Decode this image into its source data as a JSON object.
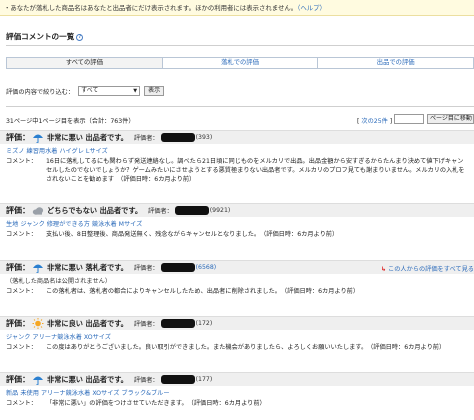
{
  "notice": {
    "text": "・あなたが落札した商品名はあなたと出品者にだけ表示されます。ほかの利用者には表示されません。",
    "help_link": "（ヘルプ）"
  },
  "section": {
    "title": "評価コメントの一覧"
  },
  "tabs": [
    {
      "label": "すべての評価",
      "active": true
    },
    {
      "label": "落札での評価",
      "active": false
    },
    {
      "label": "出品での評価",
      "active": false
    }
  ],
  "filter": {
    "label": "評価の内容で絞り込む：",
    "selected": "すべて",
    "button": "表示"
  },
  "results": {
    "summary": "31ページ中1ページ目を表示（合計：763件）",
    "next_link": "次の25件",
    "page_button": "ページ目に移動"
  },
  "colors": {
    "link": "#2a6aba",
    "header_bg": "#efefef",
    "report_mark": "#dd2222"
  },
  "reviews": [
    {
      "weather_icon": "umbrella-rain-icon",
      "label": "評価：",
      "rating": "非常に悪い 出品者です。",
      "user_label": "評価者：",
      "count": "(393)",
      "count_is_link": false,
      "item": "ミズノ 練習用水着 ハイグレ Lサイズ",
      "item_is_link": true,
      "comment_label": "コメント：",
      "comment": "16日に落札してるにも関わらず発送連絡なし。調べたら21日頃に同じものをメルカリで出品。出品金額から安すぎるからたんまり決めて値下げキャンセルしたのでないでしょうか？ゲームみたいにさせようとする悪質極まりない出品者です。メルカリのプロフ見ても謝まりいません。メルカリの入札をされないことを勧めます　（評価日時：6カ月より前）",
      "report": ""
    },
    {
      "weather_icon": "cloud-icon",
      "label": "評価：",
      "rating": "どちらでもない 出品者です。",
      "user_label": "評価者：",
      "count": "(9921)",
      "count_is_link": false,
      "item": "生地 ジャンク 修理ができる方 競泳水着 Mサイズ",
      "item_is_link": true,
      "comment_label": "コメント：",
      "comment": "支払い後、8日整理後、商品発送無く、残念ながらキャンセルとなりました。　（評価日時：6カ月より前）",
      "report": ""
    },
    {
      "weather_icon": "umbrella-rain-icon",
      "label": "評価：",
      "rating": "非常に悪い 落札者です。",
      "user_label": "評価者：",
      "count": "(6568)",
      "count_is_link": true,
      "item": "（落札した商品名は公開されません）",
      "item_is_link": false,
      "comment_label": "コメント：",
      "comment": "この落札者は、落札者の都合によりキャンセルしたため、出品者に削除されました。　（評価日時：6カ月より前）",
      "report": "この人からの評価をすべて見る"
    },
    {
      "weather_icon": "sun-icon",
      "label": "評価：",
      "rating": "非常に良い 出品者です。",
      "user_label": "評価者：",
      "count": "(172)",
      "count_is_link": false,
      "item": "ジャンク アリーナ競泳水着 XOサイズ",
      "item_is_link": true,
      "comment_label": "コメント：",
      "comment": "この度はありがとうございました。良い取引ができました。また機会がありましたら、よろしくお願いいたします。　（評価日時：6カ月より前）",
      "report": ""
    },
    {
      "weather_icon": "umbrella-rain-icon",
      "label": "評価：",
      "rating": "非常に悪い 出品者です。",
      "user_label": "評価者：",
      "count": "(177)",
      "count_is_link": false,
      "item": "新品 未使用 アリーナ競泳水着 XOサイズ ブラック&ブルー",
      "item_is_link": true,
      "comment_label": "コメント：",
      "comment": "「非常に悪い」の評価をつけさせていただきます。　（評価日時：6カ月より前）",
      "report": ""
    }
  ]
}
